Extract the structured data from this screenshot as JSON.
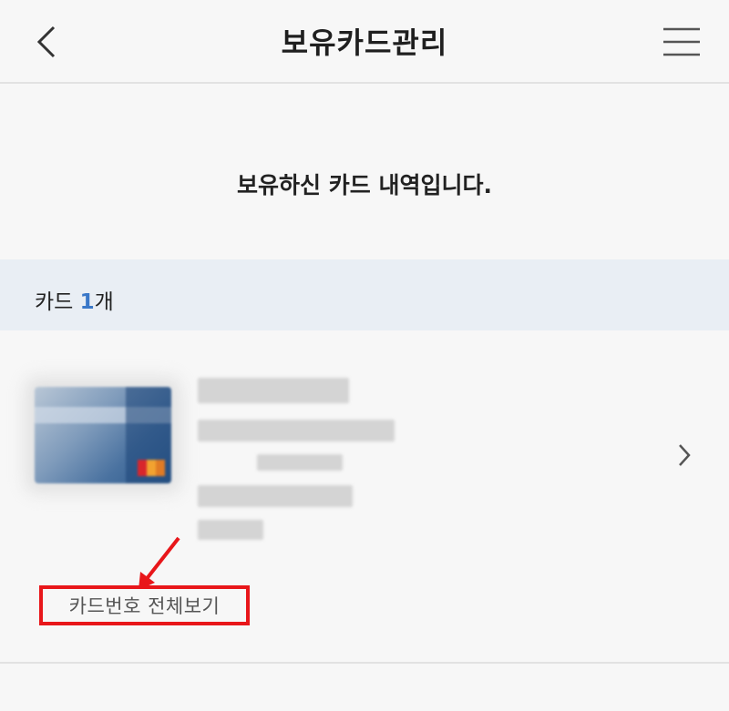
{
  "header": {
    "title": "보유카드관리",
    "back_icon": "chevron-left-icon",
    "menu_icon": "hamburger-menu-icon"
  },
  "intro": {
    "message": "보유하신 카드 내역입니다."
  },
  "card_count": {
    "label": "카드",
    "count": "1",
    "unit": "개"
  },
  "card": {
    "image_icon": "credit-card-image",
    "details_blurred": true,
    "chevron_icon": "chevron-right-icon"
  },
  "actions": {
    "view_full_number": "카드번호 전체보기"
  },
  "colors": {
    "accent_blue": "#3a78c8",
    "count_bar_bg": "#e9eef4",
    "annotation_red": "#e8161a",
    "page_bg": "#f7f7f7"
  }
}
